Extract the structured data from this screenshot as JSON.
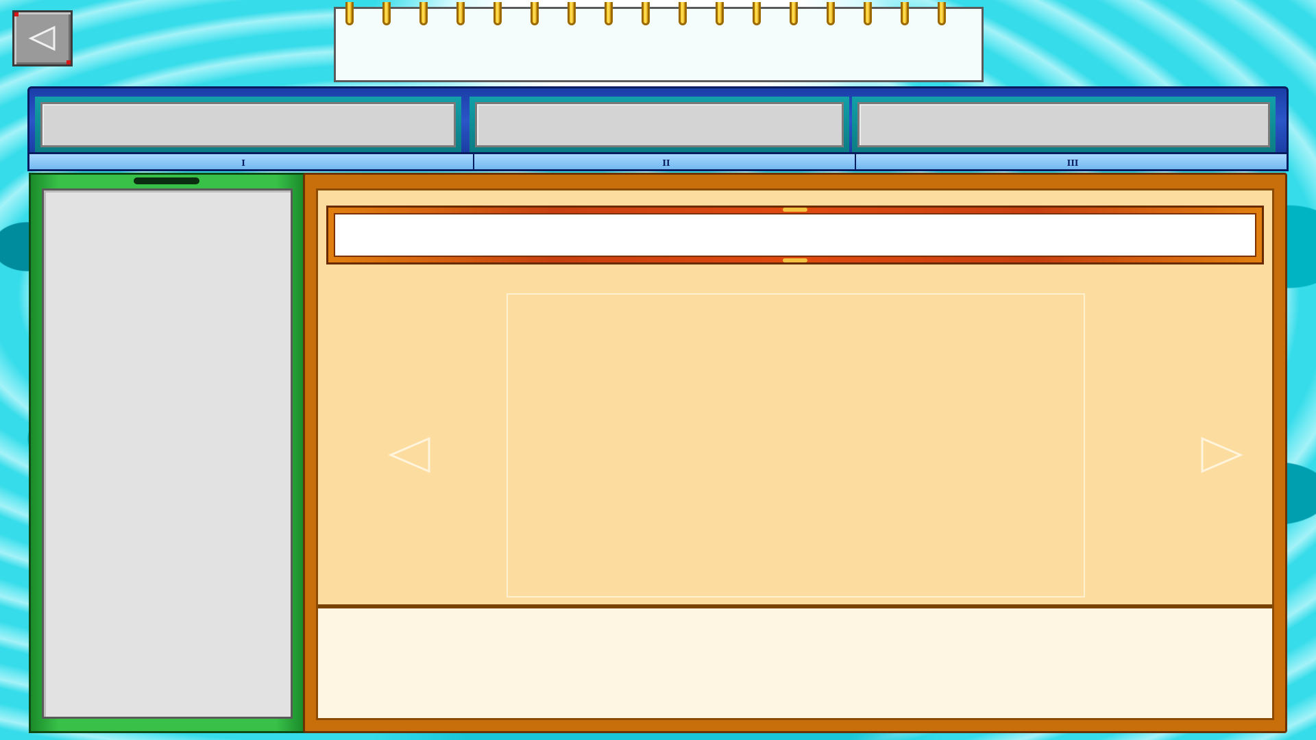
{
  "back_button": {
    "icon": "back-arrow-icon"
  },
  "notepad": {
    "title": ""
  },
  "tabs": [
    {
      "label": "",
      "numeral": "I"
    },
    {
      "label": "",
      "numeral": "II"
    },
    {
      "label": "",
      "numeral": "III"
    }
  ],
  "item_list": {
    "items": []
  },
  "detail": {
    "name_value": "",
    "name_placeholder": "",
    "description": "",
    "prev_icon": "left-arrow-icon",
    "next_icon": "right-arrow-icon"
  },
  "colors": {
    "background": "#36dcea",
    "tabbar": "#2a56c8",
    "list_panel": "#38c048",
    "detail_panel": "#c86e0a",
    "detail_inner": "#fddca0",
    "description_bg": "#fef6e2"
  }
}
